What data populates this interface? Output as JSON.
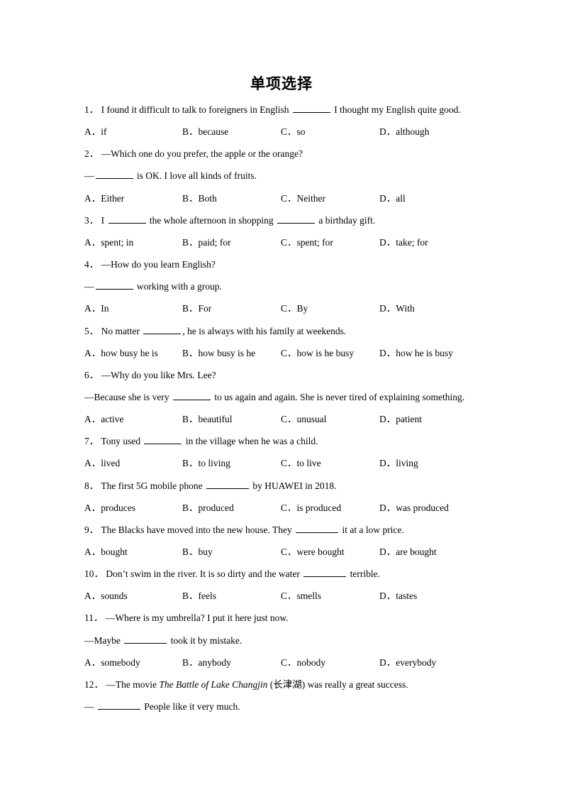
{
  "title": "单项选择",
  "questions": [
    {
      "num": "1．",
      "lines": [
        [
          "I found it difficult to talk to foreigners in English ",
          "BLANK8",
          " I thought my English quite good."
        ]
      ],
      "options": [
        "A．if",
        "B．because",
        "C．so",
        "D．although"
      ]
    },
    {
      "num": "2．",
      "lines": [
        [
          "—Which one do you prefer, the apple or the orange?"
        ],
        [
          "—",
          "BLANK8",
          " is OK. I love all kinds of fruits."
        ]
      ],
      "options": [
        "A．Either",
        "B．Both",
        "C．Neither",
        "D．all"
      ]
    },
    {
      "num": "3．",
      "lines": [
        [
          "I ",
          "BLANK8",
          " the whole afternoon in shopping ",
          "BLANK8",
          " a birthday gift."
        ]
      ],
      "options": [
        "A．spent; in",
        "B．paid; for",
        "C．spent; for",
        "D．take; for"
      ]
    },
    {
      "num": "4．",
      "lines": [
        [
          "—How do you learn English?"
        ],
        [
          "—",
          "BLANK8",
          " working with a group."
        ]
      ],
      "options": [
        "A．In",
        "B．For",
        "C．By",
        "D．With"
      ]
    },
    {
      "num": "5．",
      "lines": [
        [
          "No matter ",
          "BLANK8",
          ", he is always with his family at weekends."
        ]
      ],
      "options": [
        "A．how busy he is",
        "B．how busy is he",
        "C．how is he busy",
        "D．how he is busy"
      ]
    },
    {
      "num": "6．",
      "lines": [
        [
          "—Why do you like Mrs. Lee?"
        ],
        [
          "—Because she is very ",
          "BLANK8",
          " to us again and again. She is never tired of explaining something."
        ]
      ],
      "options": [
        "A．active",
        "B．beautiful",
        "C．unusual",
        "D．patient"
      ]
    },
    {
      "num": "7．",
      "lines": [
        [
          "Tony used ",
          "BLANK8",
          " in the village when he was a child."
        ]
      ],
      "options": [
        "A．lived",
        "B．to living",
        "C．to live",
        "D．living"
      ]
    },
    {
      "num": "8．",
      "lines": [
        [
          "The first 5G mobile phone ",
          "BLANK9",
          " by HUAWEI in 2018."
        ]
      ],
      "options": [
        "A．produces",
        "B．produced",
        "C．is produced",
        "D．was produced"
      ]
    },
    {
      "num": "9．",
      "lines": [
        [
          "The Blacks have moved into the new house. They ",
          "BLANK9",
          " it at a low price."
        ]
      ],
      "options": [
        "A．bought",
        "B．buy",
        "C．were bought",
        "D．are bought"
      ]
    },
    {
      "num": "10．",
      "lines": [
        [
          "Don’t swim in the river. It is so dirty and the water ",
          "BLANK9",
          " terrible."
        ]
      ],
      "options": [
        "A．sounds",
        "B．feels",
        "C．smells",
        "D．tastes"
      ]
    },
    {
      "num": "11．",
      "lines": [
        [
          "—Where is my umbrella? I put it here just now."
        ],
        [
          "—Maybe ",
          "BLANK9",
          " took it by mistake."
        ]
      ],
      "options": [
        "A．somebody",
        "B．anybody",
        "C．nobody",
        "D．everybody"
      ]
    },
    {
      "num": "12．",
      "lines": [
        [
          "—The movie ",
          "ITALIC:The Battle of Lake Changjin",
          " (长津湖) was really a great success."
        ],
        [
          "— ",
          "BLANK9",
          " People like it very much."
        ]
      ],
      "options": []
    }
  ]
}
